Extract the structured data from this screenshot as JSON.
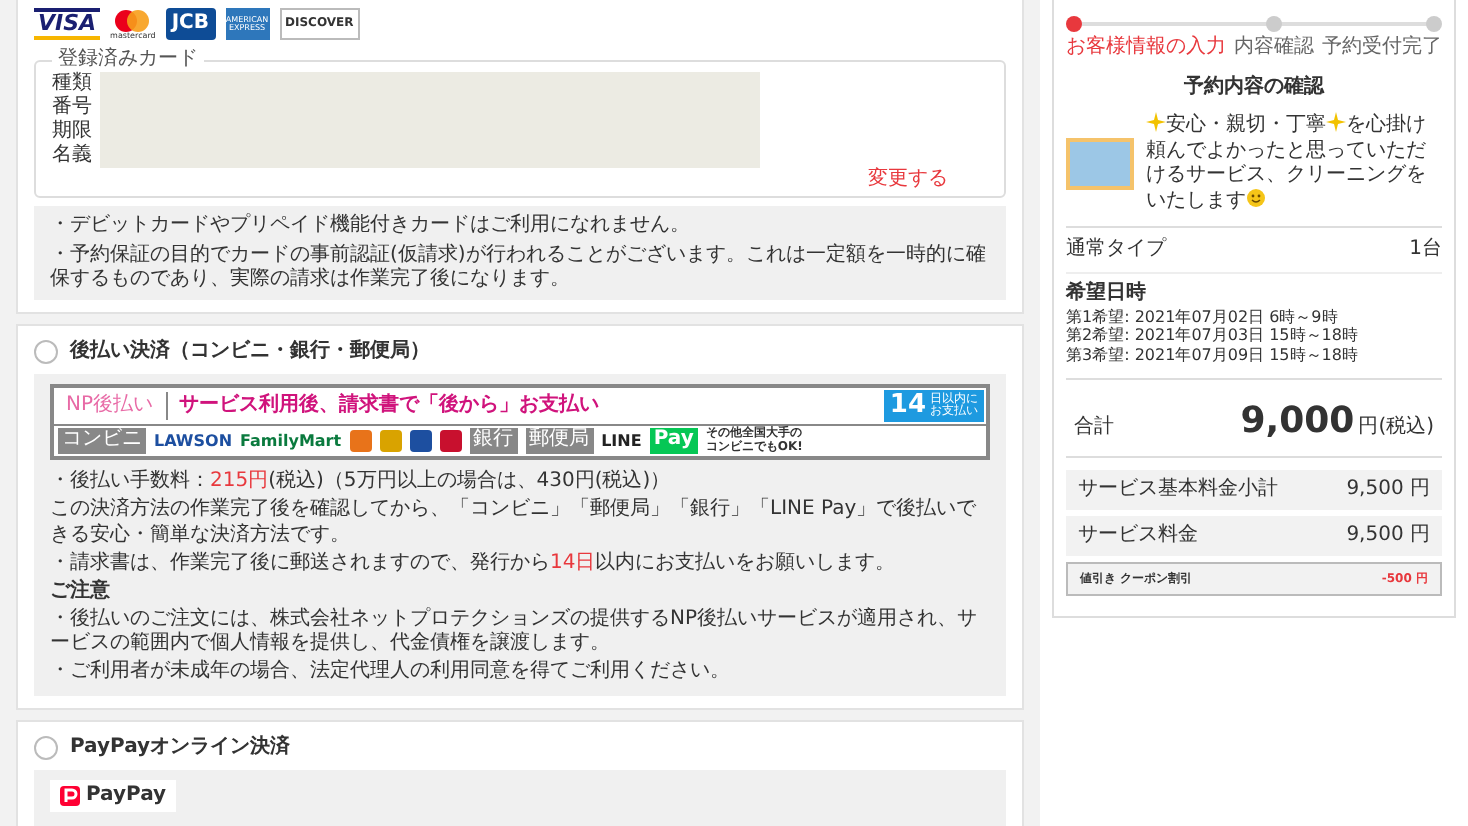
{
  "card_payment": {
    "brands": [
      {
        "kind": "visa",
        "label": "VISA"
      },
      {
        "kind": "mastercard",
        "label": "mastercard"
      },
      {
        "kind": "jcb",
        "label": "JCB"
      },
      {
        "kind": "amex",
        "label": "AMERICAN EXPRESS"
      },
      {
        "kind": "discover",
        "label": "DISCOVER"
      }
    ],
    "registered_card": {
      "legend": "登録済みカード",
      "labels": [
        "種類",
        "番号",
        "期限",
        "名義"
      ],
      "change_link": "変更する"
    },
    "notes": [
      "・デビットカードやプリペイド機能付きカードはご利用になれません。",
      "・予約保証の目的でカードの事前認証(仮請求)が行われることがございます。これは一定額を一時的に確保するものであり、実際の請求は作業完了後になります。"
    ]
  },
  "deferred_payment": {
    "selected": false,
    "label": "後払い決済（コンビニ・銀行・郵便局）",
    "banner": {
      "logo": "NP後払い",
      "message": "サービス利用後、請求書で「後から」お支払い",
      "deadline_number": "14",
      "deadline_text": [
        "日以内に",
        "お支払い"
      ],
      "outlets": [
        {
          "kind": "tag",
          "text": "コンビニ"
        },
        {
          "kind": "brand",
          "text": "LAWSON",
          "color": "#1d4fa0"
        },
        {
          "kind": "brand",
          "text": "FamilyMart",
          "color": "#0a7a3e"
        },
        {
          "kind": "logo",
          "color": "#e8731a"
        },
        {
          "kind": "logo",
          "color": "#d9a300"
        },
        {
          "kind": "logo",
          "color": "#1d4fa0"
        },
        {
          "kind": "logo",
          "color": "#c8102e"
        },
        {
          "kind": "tag",
          "text": "銀行"
        },
        {
          "kind": "tag",
          "text": "郵便局"
        },
        {
          "kind": "brand",
          "text": "LINE",
          "color": "#222222"
        },
        {
          "kind": "pay",
          "text": "Pay"
        }
      ],
      "outlets_note": [
        "その他全国大手の",
        "コンビニでもOK!"
      ]
    },
    "notes": [
      {
        "kind": "text",
        "segments": [
          {
            "text": "・後払い手数料：",
            "highlight": false
          },
          {
            "text": "215円",
            "highlight": true
          },
          {
            "text": "(税込)（5万円以上の場合は、430円(税込)）",
            "highlight": false
          }
        ]
      },
      {
        "kind": "text",
        "segments": [
          {
            "text": "この決済方法の作業完了後を確認してから、「コンビニ」「郵便局」「銀行」「LINE Pay」で後払いできる安心・簡単な決済方法です。",
            "highlight": false
          }
        ]
      },
      {
        "kind": "text",
        "segments": [
          {
            "text": "・請求書は、作業完了後に郵送されますので、発行から",
            "highlight": false
          },
          {
            "text": "14日",
            "highlight": true
          },
          {
            "text": "以内にお支払いをお願いします。",
            "highlight": false
          }
        ]
      },
      {
        "kind": "heading",
        "segments": [
          {
            "text": "ご注意",
            "highlight": false
          }
        ]
      },
      {
        "kind": "text",
        "segments": [
          {
            "text": "・後払いのご注文には、株式会社ネットプロテクションズの提供するNP後払いサービスが適用され、サービスの範囲内で個人情報を提供し、代金債権を譲渡します。",
            "highlight": false
          }
        ]
      },
      {
        "kind": "text",
        "segments": [
          {
            "text": "・ご利用者が未成年の場合、法定代理人の利用同意を得てご利用ください。",
            "highlight": false
          }
        ]
      }
    ]
  },
  "paypay": {
    "selected": false,
    "label": "PayPayオンライン決済",
    "logo": "PayPay"
  },
  "summary": {
    "steps": [
      {
        "label": "お客様情報の入力",
        "selected": true
      },
      {
        "label": "内容確認",
        "selected": false
      },
      {
        "label": "予約受付完了",
        "selected": false
      }
    ],
    "title": "予約内容の確認",
    "description": [
      "安心・親切・丁寧",
      "を心掛け頼んでよかったと思っていただけるサービス、クリーニングをいたします"
    ],
    "plan": {
      "label": "通常タイプ",
      "quantity": "1台"
    },
    "dates": {
      "heading": "希望日時",
      "lines": [
        "第1希望: 2021年07月02日 6時～9時",
        "第2希望: 2021年07月03日 15時～18時",
        "第3希望: 2021年07月09日 15時～18時"
      ]
    },
    "total": {
      "label": "合計",
      "amount": "9,000",
      "unit": "円(税込)"
    },
    "breakdown": [
      {
        "kind": "normal",
        "label": "サービス基本料金小計",
        "amount": "9,500 円"
      },
      {
        "kind": "normal",
        "label": "サービス料金",
        "amount": "9,500 円"
      },
      {
        "kind": "discount",
        "label": "値引き クーポン割引",
        "amount": "-500 円"
      }
    ]
  }
}
